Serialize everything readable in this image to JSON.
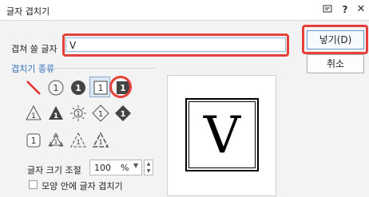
{
  "window": {
    "title": "글자 겹치기"
  },
  "form": {
    "text_label": "겹쳐 쓸 글자",
    "text_value": "V",
    "style_section": "겹치기 종류",
    "size_label": "글자 크기 조절",
    "size_value": "100",
    "size_unit": "%",
    "checkbox_label": "모양 안에 글자 겹치기",
    "checkbox_checked": false
  },
  "buttons": {
    "insert": "넣기(D)",
    "cancel": "취소"
  },
  "styles": [
    "none-slash",
    "circle-outline",
    "circle-filled",
    "square-outline-selected",
    "square-filled",
    "triangle-outline",
    "triangle-filled",
    "sun-outline",
    "diamond-outline",
    "diamond-filled",
    "square-rounded",
    "recycle-outline",
    "recycle-outline-2",
    "recycle-outline-3"
  ],
  "style_glyph": "1",
  "preview": {
    "char": "V"
  },
  "accent": "#e5403a"
}
